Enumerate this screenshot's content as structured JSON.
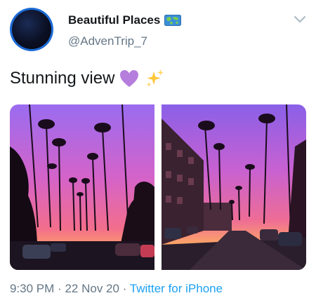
{
  "tweet": {
    "display_name": "Beautiful Places",
    "display_name_emoji": "world-map-icon",
    "handle": "@AdvenTrip_7",
    "text": "Stunning view",
    "text_emojis": [
      "purple-heart-icon",
      "sparkles-icon"
    ],
    "media": [
      {
        "kind": "photo",
        "subject": "palm-trees-sunset-street"
      },
      {
        "kind": "photo",
        "subject": "palm-trees-sunset-street-buildings"
      }
    ],
    "time": "9:30 PM",
    "separator": "·",
    "date": "22 Nov 20",
    "source": "Twitter for iPhone"
  },
  "colors": {
    "name": "#14171a",
    "secondary": "#657786",
    "link": "#1da1f2",
    "heart": "#b57edc",
    "sparkle": "#ffc83d",
    "avatar_ring": "#1c6bd6"
  }
}
